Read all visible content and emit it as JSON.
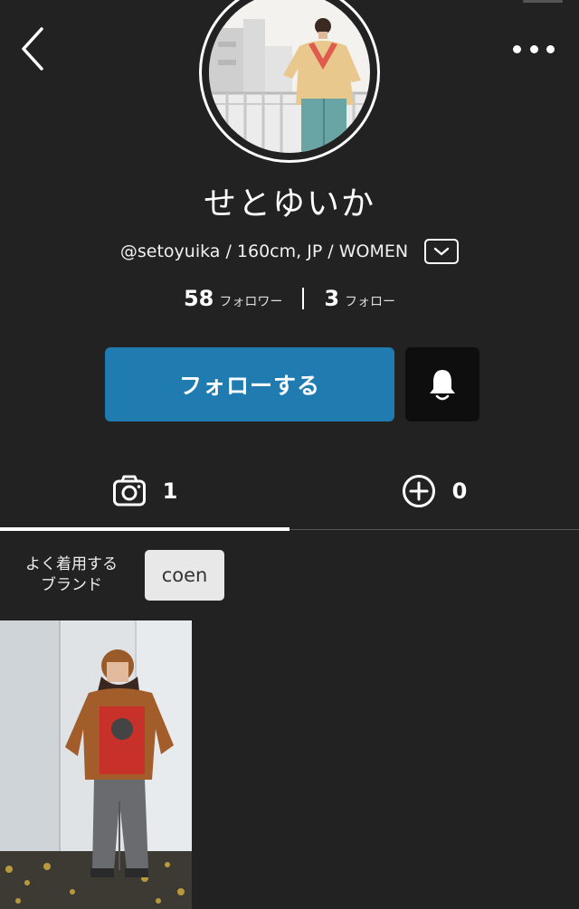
{
  "header": {
    "back_icon": "chevron-left-icon",
    "more_icon": "more-horizontal-icon"
  },
  "profile": {
    "name": "せとゆいか",
    "meta": "@setoyuika / 160cm, JP / WOMEN",
    "expand_icon": "chevron-down-icon"
  },
  "stats": {
    "followers_count": "58",
    "followers_label": "フォロワー",
    "following_count": "3",
    "following_label": "フォロー"
  },
  "actions": {
    "follow_label": "フォローする",
    "bell_icon": "bell-icon",
    "follow_color": "#1f7bb0"
  },
  "tabs": [
    {
      "icon": "camera-icon",
      "count": "1",
      "active": true
    },
    {
      "icon": "plus-circle-icon",
      "count": "0",
      "active": false
    }
  ],
  "brands": {
    "label_line1": "よく着用する",
    "label_line2": "ブランド",
    "items": [
      "coen"
    ]
  }
}
